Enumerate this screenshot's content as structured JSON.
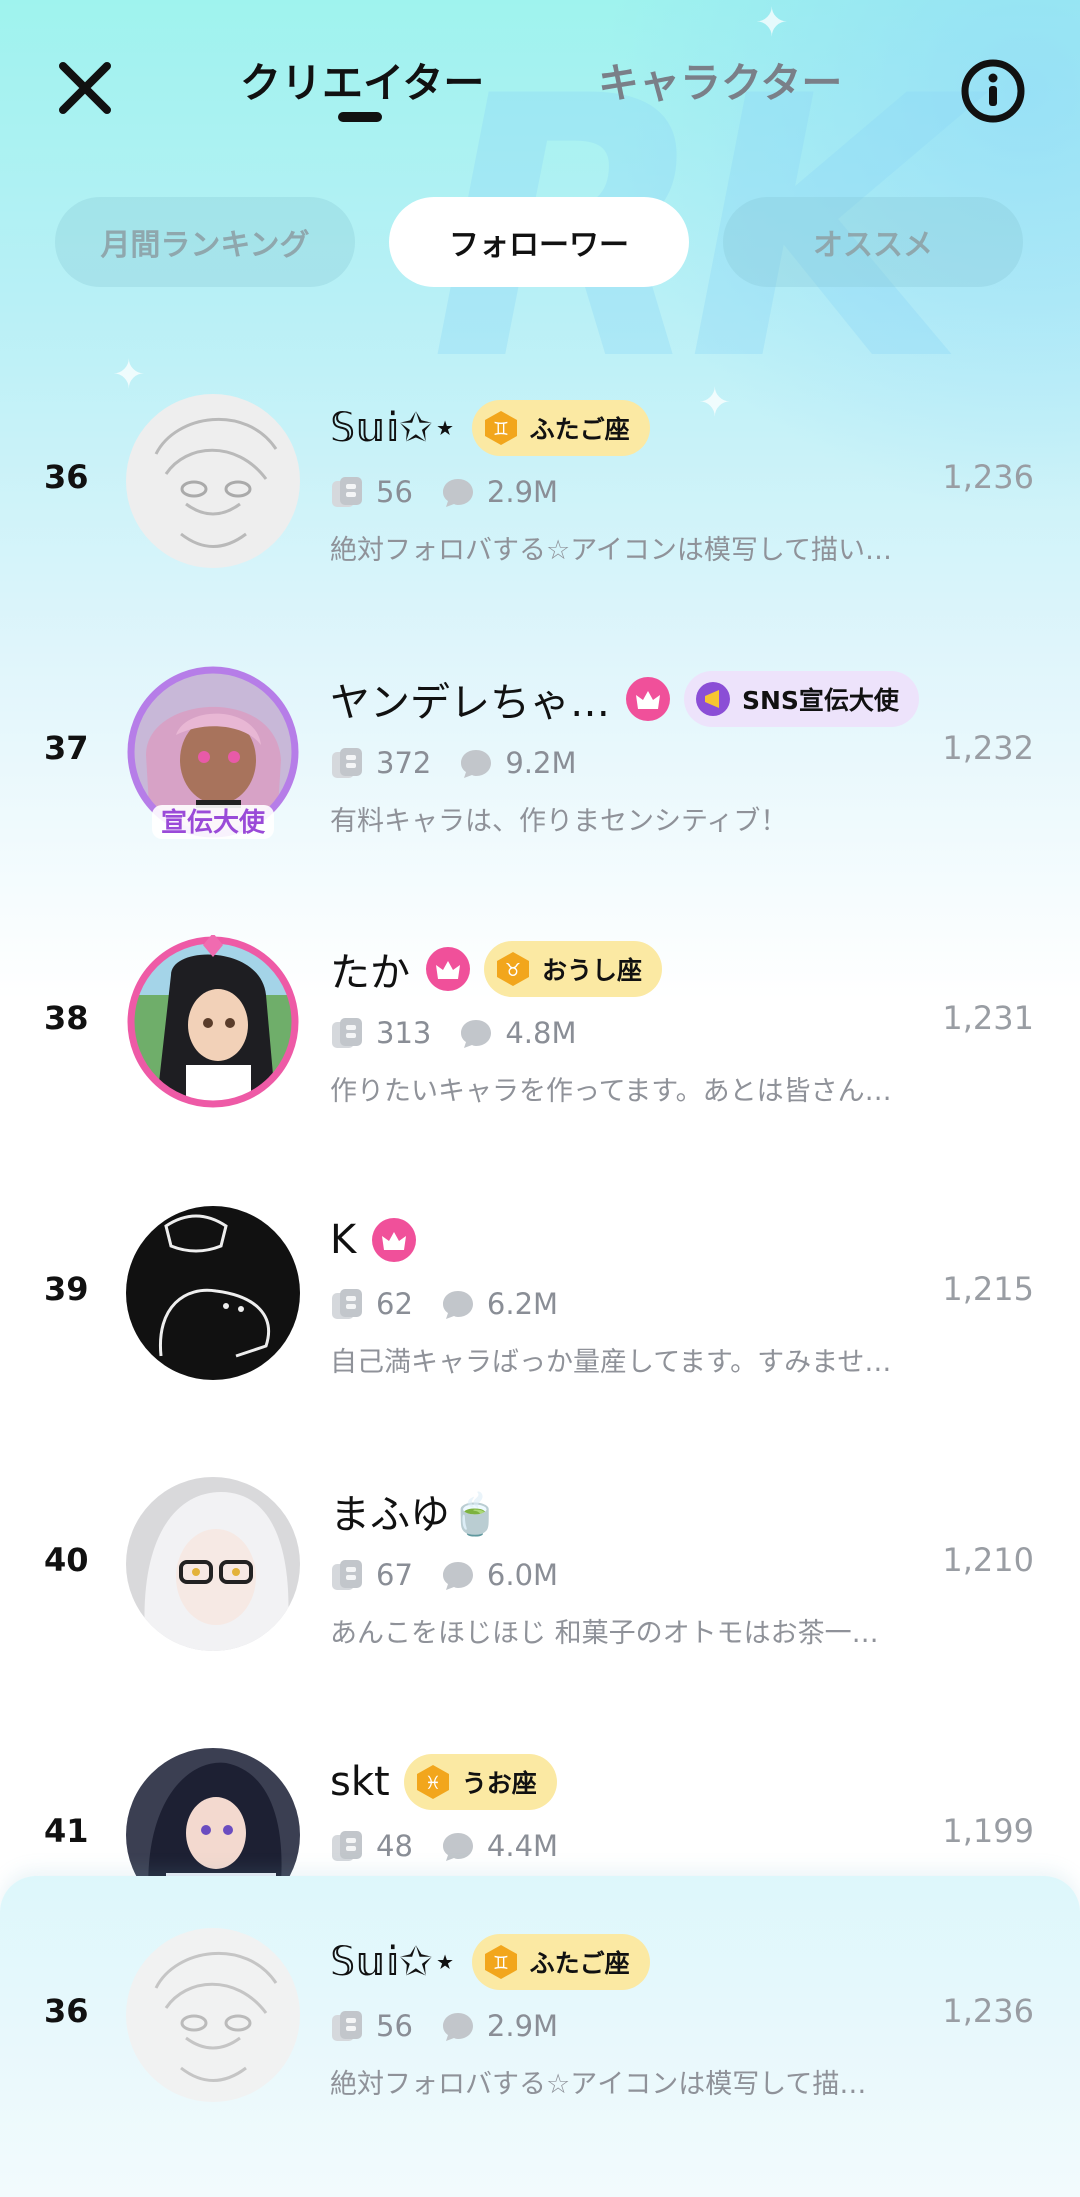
{
  "header": {
    "tabs": [
      {
        "label": "クリエイター",
        "active": true
      },
      {
        "label": "キャラクター",
        "active": false
      }
    ]
  },
  "filters": [
    {
      "label": "月間ランキング",
      "active": false
    },
    {
      "label": "フォローワー",
      "active": true
    },
    {
      "label": "オススメ",
      "active": false
    }
  ],
  "rows": [
    {
      "rank": "36",
      "name": "𝕊𝕦𝕚✩⋆",
      "crown": false,
      "badge": "ふたご座",
      "badge_symbol": "♊",
      "characters": "56",
      "chats": "2.9M",
      "desc": "絶対フォロバする☆アイコンは模写して描い…",
      "followers": "1,236"
    },
    {
      "rank": "37",
      "name": "ヤンデレちゃ…",
      "crown": true,
      "badge": "SNS宣伝大使",
      "badge_symbol": "📣",
      "characters": "372",
      "chats": "9.2M",
      "desc": "有料キャラは、作りまセンシティブ！",
      "followers": "1,232",
      "avatar_label": "宣伝大使"
    },
    {
      "rank": "38",
      "name": "たか",
      "crown": true,
      "badge": "おうし座",
      "badge_symbol": "♉",
      "characters": "313",
      "chats": "4.8M",
      "desc": "作りたいキャラを作ってます。あとは皆さん…",
      "followers": "1,231"
    },
    {
      "rank": "39",
      "name": "K",
      "crown": true,
      "badge": "",
      "characters": "62",
      "chats": "6.2M",
      "desc": "自己満キャラばっか量産してます。すみませ…",
      "followers": "1,215"
    },
    {
      "rank": "40",
      "name": "まふゆ🍵",
      "crown": false,
      "badge": "",
      "characters": "67",
      "chats": "6.0M",
      "desc": "あんこをほじほじ 和菓子のオトモはお茶一…",
      "followers": "1,210"
    },
    {
      "rank": "41",
      "name": "skt",
      "crown": false,
      "badge": "うお座",
      "badge_symbol": "♓",
      "characters": "48",
      "chats": "4.4M",
      "desc": "",
      "followers": "1,199"
    }
  ],
  "my_rank": {
    "rank": "36",
    "name": "𝕊𝕦𝕚✩⋆",
    "badge": "ふたご座",
    "badge_symbol": "♊",
    "characters": "56",
    "chats": "2.9M",
    "desc": "絶対フォロバする☆アイコンは模写して描…",
    "followers": "1,236"
  },
  "colors": {
    "accent_pink": "#f0509a",
    "badge_yellow": "#fbe9a3",
    "badge_purple": "#ede3fb",
    "hex_orange": "#f2a61c"
  }
}
